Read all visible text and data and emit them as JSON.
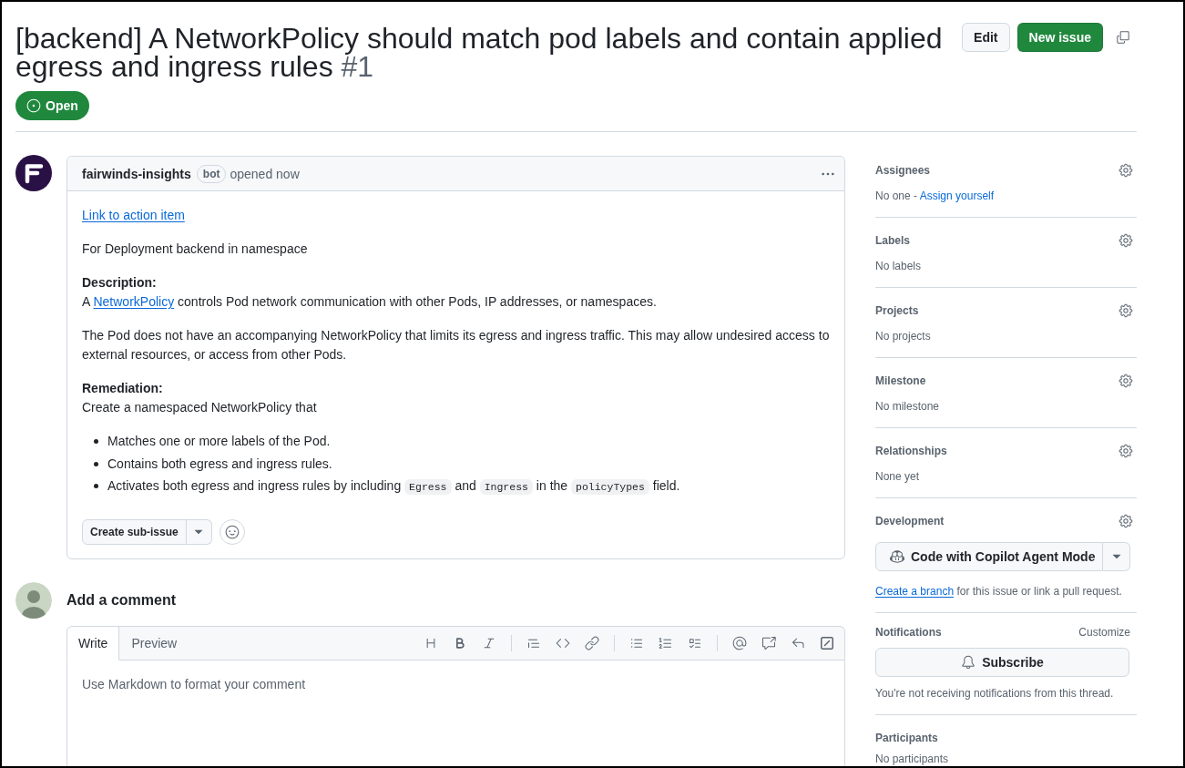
{
  "issue": {
    "title": "[backend] A NetworkPolicy should match pod labels and contain applied egress and ingress rules",
    "number": "#1",
    "state": {
      "kind": "open",
      "label": "Open"
    }
  },
  "header_actions": {
    "edit": "Edit",
    "new_issue": "New issue"
  },
  "post": {
    "author": "fairwinds-insights",
    "author_badge": "bot",
    "timestamp": "opened now",
    "body": [
      {
        "kind": "link",
        "text": "Link to action item"
      },
      {
        "kind": "paragraph",
        "parts": [
          {
            "kind": "text",
            "text": "For Deployment backend in namespace"
          }
        ]
      },
      {
        "kind": "section",
        "heading": "Description:",
        "parts": [
          {
            "kind": "text",
            "text": "A "
          },
          {
            "kind": "link",
            "text": "NetworkPolicy"
          },
          {
            "kind": "text",
            "text": " controls Pod network communication with other Pods, IP addresses, or namespaces."
          }
        ]
      },
      {
        "kind": "paragraph",
        "parts": [
          {
            "kind": "text",
            "text": "The Pod does not have an accompanying NetworkPolicy that limits its egress and ingress traffic. This may allow undesired access to external resources, or access from other Pods."
          }
        ]
      },
      {
        "kind": "section",
        "heading": "Remediation:",
        "parts": [
          {
            "kind": "text",
            "text": "Create a namespaced NetworkPolicy that"
          }
        ]
      },
      {
        "kind": "list",
        "items": [
          {
            "parts": [
              {
                "kind": "text",
                "text": "Matches one or more labels of the Pod."
              }
            ]
          },
          {
            "parts": [
              {
                "kind": "text",
                "text": "Contains both egress and ingress rules."
              }
            ]
          },
          {
            "parts": [
              {
                "kind": "text",
                "text": "Activates both egress and ingress rules by including "
              },
              {
                "kind": "code",
                "text": "Egress"
              },
              {
                "kind": "text",
                "text": " and "
              },
              {
                "kind": "code",
                "text": "Ingress"
              },
              {
                "kind": "text",
                "text": " in the "
              },
              {
                "kind": "code",
                "text": "policyTypes"
              },
              {
                "kind": "text",
                "text": " field."
              }
            ]
          }
        ]
      }
    ],
    "sub_issue_button": "Create sub-issue"
  },
  "comment_box": {
    "heading": "Add a comment",
    "tabs": [
      {
        "label": "Write",
        "selected": true
      },
      {
        "label": "Preview",
        "selected": false
      }
    ],
    "placeholder": "Use Markdown to format your comment"
  },
  "sidebar": [
    {
      "kind": "field",
      "title": "Assignees",
      "value": [
        {
          "kind": "text",
          "text": "No one - "
        },
        {
          "kind": "link",
          "text": "Assign yourself"
        }
      ]
    },
    {
      "kind": "field",
      "title": "Labels",
      "value": [
        {
          "kind": "text",
          "text": "No labels"
        }
      ]
    },
    {
      "kind": "field",
      "title": "Projects",
      "value": [
        {
          "kind": "text",
          "text": "No projects"
        }
      ]
    },
    {
      "kind": "field",
      "title": "Milestone",
      "value": [
        {
          "kind": "text",
          "text": "No milestone"
        }
      ]
    },
    {
      "kind": "field",
      "title": "Relationships",
      "value": [
        {
          "kind": "text",
          "text": "None yet"
        }
      ]
    },
    {
      "kind": "development",
      "title": "Development",
      "button": "Code with Copilot Agent Mode",
      "note": [
        {
          "kind": "link",
          "text": "Create a branch"
        },
        {
          "kind": "text",
          "text": " for this issue or link a pull request."
        }
      ]
    },
    {
      "kind": "notifications",
      "title": "Notifications",
      "action": "Customize",
      "button": "Subscribe",
      "note": [
        {
          "kind": "text",
          "text": "You're not receiving notifications from this thread."
        }
      ]
    },
    {
      "kind": "plain",
      "title": "Participants",
      "value": [
        {
          "kind": "text",
          "text": "No participants"
        }
      ]
    }
  ]
}
